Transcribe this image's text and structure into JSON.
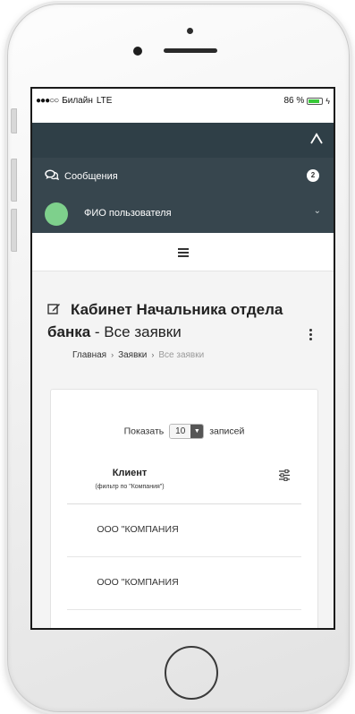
{
  "status_bar": {
    "signal": "●●●○○",
    "carrier": "Билайн",
    "network": "LTE",
    "battery_percent": "86 %",
    "battery_level": 0.86,
    "charging_icon": "bolt-icon"
  },
  "topbar": {
    "brand_icon": "mountain-logo-icon"
  },
  "sidebar": {
    "messages_label": "Сообщения",
    "messages_icon": "chat-bubbles-icon",
    "messages_count": "2",
    "user_name": "ФИО пользователя",
    "user_avatar_color": "#7ed08c"
  },
  "menu": {
    "hamburger_icon": "hamburger-menu-icon"
  },
  "page": {
    "title_bold": "Кабинет Начальника отдела банка",
    "title_sep": " - ",
    "title_rest": "Все заявки",
    "breadcrumb": [
      "Главная",
      "Заявки",
      "Все заявки"
    ]
  },
  "table": {
    "show_label": "Показать",
    "page_size": "10",
    "entries_label": "записей",
    "column_title": "Клиент",
    "column_sub": "(фильтр по \"Компания\")",
    "rows": [
      "ООО \"КОМПАНИЯ",
      "ООО \"КОМПАНИЯ"
    ]
  },
  "colors": {
    "topbar": "#2f3f47",
    "sidebar": "#37464e",
    "battery_fill": "#37c837"
  }
}
